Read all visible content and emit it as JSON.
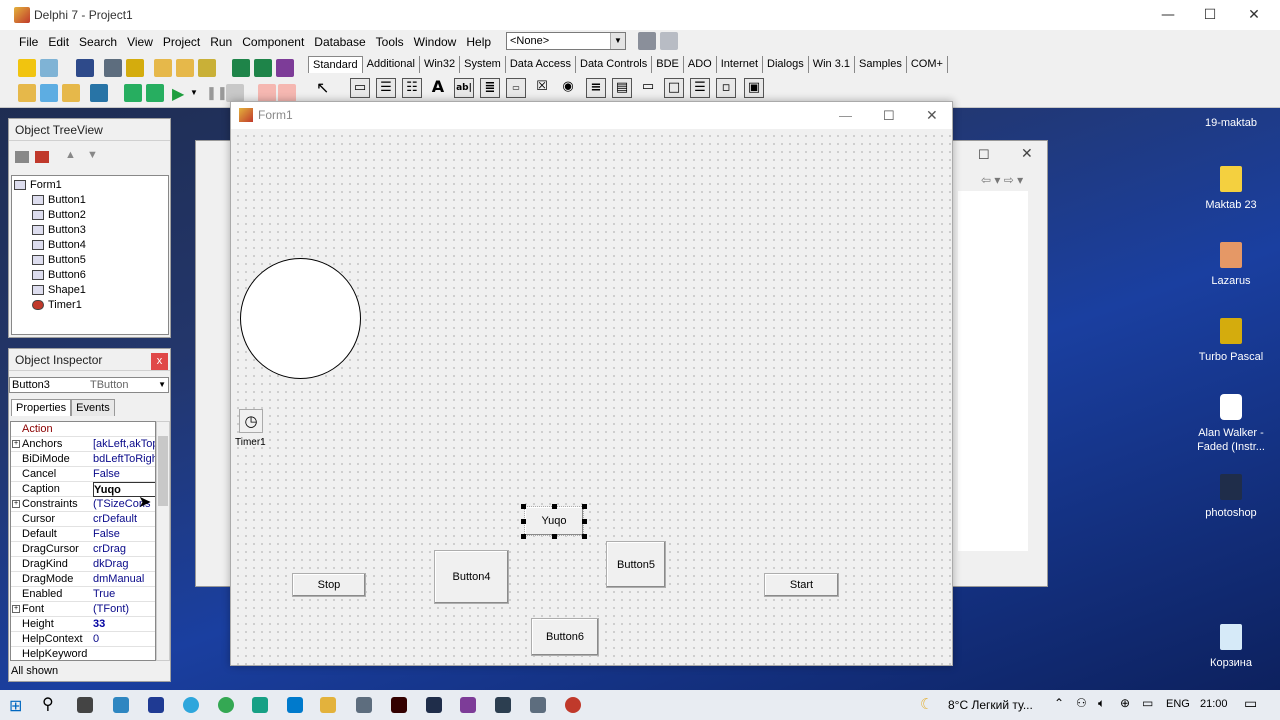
{
  "ide": {
    "title": "Delphi 7 - Project1",
    "menu": [
      "File",
      "Edit",
      "Search",
      "View",
      "Project",
      "Run",
      "Component",
      "Database",
      "Tools",
      "Window",
      "Help"
    ],
    "combo_value": "<None>",
    "palette_tabs": [
      "Standard",
      "Additional",
      "Win32",
      "System",
      "Data Access",
      "Data Controls",
      "BDE",
      "ADO",
      "Internet",
      "Dialogs",
      "Win 3.1",
      "Samples",
      "COM+"
    ],
    "palette_glyphs": [
      "A",
      "ab|"
    ]
  },
  "tree": {
    "title": "Object TreeView",
    "nodes": [
      "Form1",
      "Button1",
      "Button2",
      "Button3",
      "Button4",
      "Button5",
      "Button6",
      "Shape1",
      "Timer1"
    ]
  },
  "inspector": {
    "title": "Object Inspector",
    "close": "x",
    "selected_name": "Button3",
    "selected_type": "TButton",
    "tabs": [
      "Properties",
      "Events"
    ],
    "properties": [
      {
        "name": "Action",
        "value": ""
      },
      {
        "name": "Anchors",
        "value": "[akLeft,akTop"
      },
      {
        "name": "BiDiMode",
        "value": "bdLeftToRight"
      },
      {
        "name": "Cancel",
        "value": "False"
      },
      {
        "name": "Caption",
        "value": "Yuqo"
      },
      {
        "name": "Constraints",
        "value": "(TSizeCons"
      },
      {
        "name": "Cursor",
        "value": "crDefault"
      },
      {
        "name": "Default",
        "value": "False"
      },
      {
        "name": "DragCursor",
        "value": "crDrag"
      },
      {
        "name": "DragKind",
        "value": "dkDrag"
      },
      {
        "name": "DragMode",
        "value": "dmManual"
      },
      {
        "name": "Enabled",
        "value": "True"
      },
      {
        "name": "Font",
        "value": "(TFont)"
      },
      {
        "name": "Height",
        "value": "33"
      },
      {
        "name": "HelpContext",
        "value": "0"
      },
      {
        "name": "HelpKeyword",
        "value": ""
      }
    ],
    "status": "All shown"
  },
  "form": {
    "title": "Form1",
    "timer_label": "Timer1",
    "buttons": {
      "stop": "Stop",
      "button4": "Button4",
      "yuqo": "Yuqo",
      "button5": "Button5",
      "start": "Start",
      "button6": "Button6"
    }
  },
  "desktop": {
    "icons": [
      "19-maktab",
      "Maktab 23",
      "Lazarus",
      "Turbo Pascal",
      "Alan Walker - Faded (Instr...",
      "photoshop",
      "Корзина"
    ]
  },
  "taskbar": {
    "weather": "8°C  Легкий ту...",
    "lang": "ENG",
    "time": "21:00"
  }
}
